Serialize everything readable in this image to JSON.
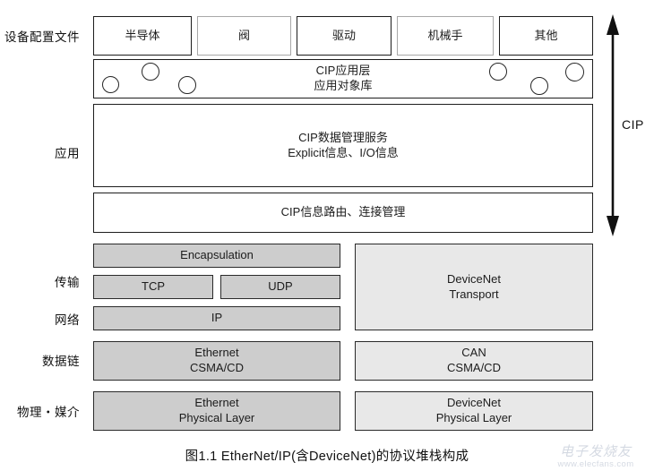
{
  "diagram": {
    "caption": "图1.1 EtherNet/IP(含DeviceNet)的协议堆栈构成",
    "cip_bracket_label": "CIP",
    "colors": {
      "gray_dark": "#cdcdcd",
      "gray_light": "#e8e8e8",
      "outline_dark": "#1d1d1d",
      "outline_light": "#a8a8a8",
      "text": "#1c1c1c"
    },
    "row_labels": [
      {
        "id": "device-profiles",
        "text": "设备配置文件"
      },
      {
        "id": "application",
        "text": "应用"
      },
      {
        "id": "transport",
        "text": "传输"
      },
      {
        "id": "network",
        "text": "网络"
      },
      {
        "id": "data-link",
        "text": "数据链"
      },
      {
        "id": "physical-media",
        "text": "物理・媒介"
      }
    ],
    "device_profiles": [
      {
        "id": "semiconductor",
        "text": "半导体",
        "style": "dark"
      },
      {
        "id": "valve",
        "text": "阀",
        "style": "light"
      },
      {
        "id": "drive",
        "text": "驱动",
        "style": "dark"
      },
      {
        "id": "robot",
        "text": "机械手",
        "style": "light"
      },
      {
        "id": "other",
        "text": "其他",
        "style": "dark"
      }
    ],
    "cip_layers": [
      {
        "id": "cip-application-layer",
        "line1": "CIP应用层",
        "line2": "应用对象库"
      },
      {
        "id": "cip-data-management",
        "line1": "CIP数据管理服务",
        "line2": "Explicit信息、I/O信息"
      },
      {
        "id": "cip-message-routing",
        "line1": "CIP信息路由、连接管理",
        "line2": ""
      }
    ],
    "ethernet_stack": [
      {
        "id": "encapsulation",
        "line1": "Encapsulation",
        "line2": ""
      },
      {
        "id": "tcp",
        "line1": "TCP",
        "line2": ""
      },
      {
        "id": "udp",
        "line1": "UDP",
        "line2": ""
      },
      {
        "id": "ip",
        "line1": "IP",
        "line2": ""
      },
      {
        "id": "ethernet-csmacd",
        "line1": "Ethernet",
        "line2": "CSMA/CD"
      },
      {
        "id": "ethernet-physical-layer",
        "line1": "Ethernet",
        "line2": "Physical Layer"
      }
    ],
    "devicenet_stack": [
      {
        "id": "devicenet-transport",
        "line1": "DeviceNet",
        "line2": "Transport"
      },
      {
        "id": "can-csmacd",
        "line1": "CAN",
        "line2": "CSMA/CD"
      },
      {
        "id": "devicenet-physical-layer",
        "line1": "DeviceNet",
        "line2": "Physical Layer"
      }
    ]
  },
  "watermark": {
    "brand": "电子发烧友",
    "url": "www.elecfans.com"
  }
}
